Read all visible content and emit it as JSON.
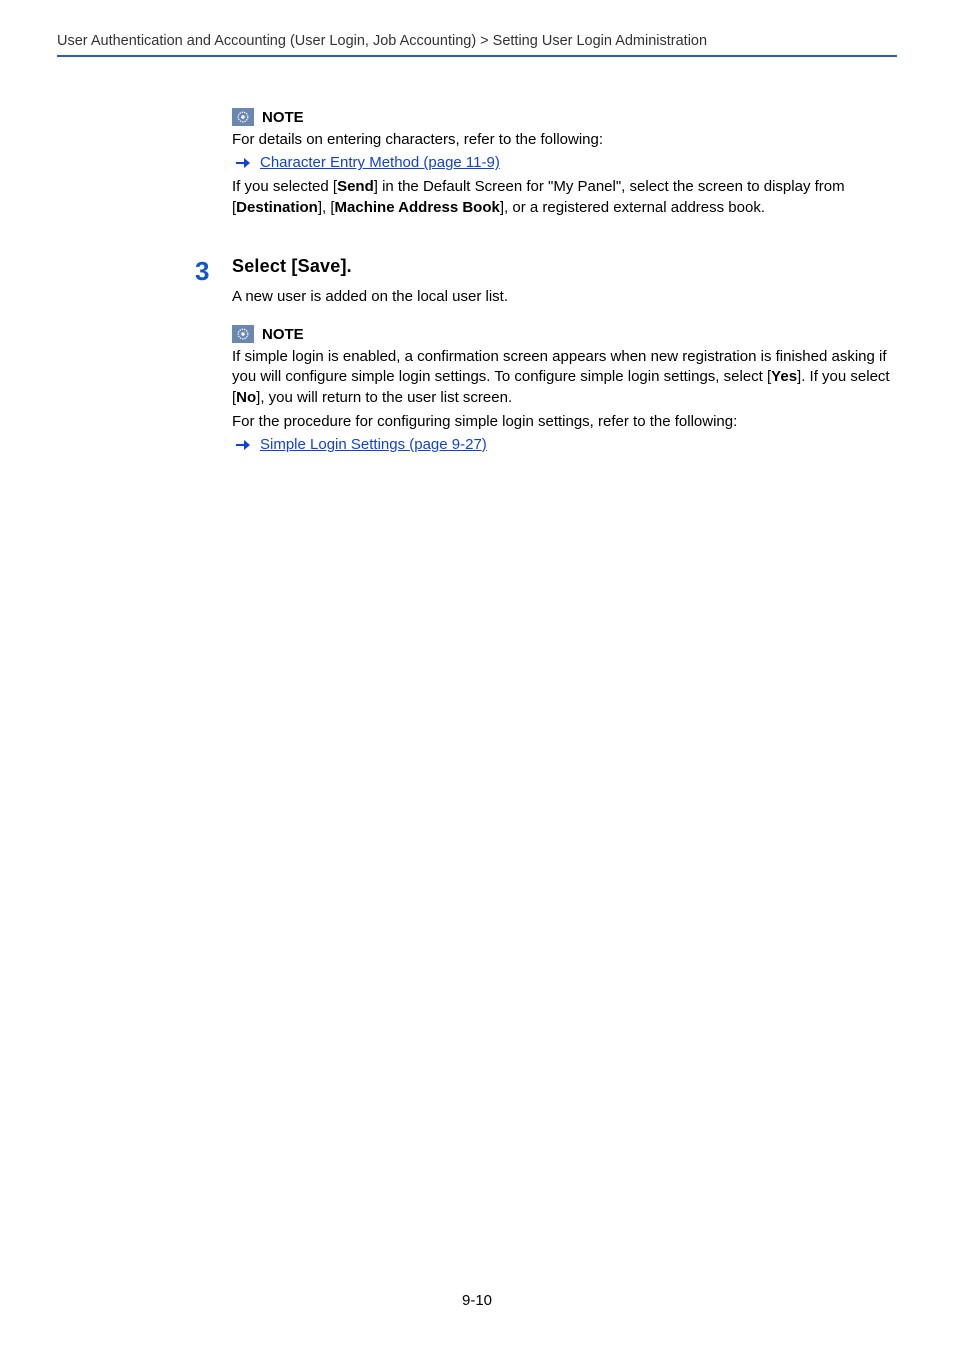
{
  "breadcrumb": "User Authentication and Accounting (User Login, Job Accounting) > Setting User Login Administration",
  "note1": {
    "label": "NOTE",
    "line1": "For details on entering characters, refer to the following:",
    "link": "Character Entry Method (page 11-9)",
    "p2_pre": "If you selected [",
    "p2_b1": "Send",
    "p2_mid1": "] in the Default Screen for \"My Panel\", select the screen to display from [",
    "p2_b2": "Destination",
    "p2_mid2": "], [",
    "p2_b3": "Machine Address Book",
    "p2_post": "], or a registered external address book."
  },
  "step3": {
    "number": "3",
    "heading": "Select [Save].",
    "line1": "A new user is added on the local user list."
  },
  "note2": {
    "label": "NOTE",
    "p1_pre": "If simple login is enabled, a confirmation screen appears when new registration is finished asking if you will configure simple login settings. To configure simple login settings, select [",
    "p1_b1": "Yes",
    "p1_mid": "]. If you select [",
    "p1_b2": "No",
    "p1_post": "], you will return to the user list screen.",
    "line2": "For the procedure for configuring simple login settings, refer to the following:",
    "link": "Simple Login Settings (page 9-27)"
  },
  "pageNumber": "9-10"
}
